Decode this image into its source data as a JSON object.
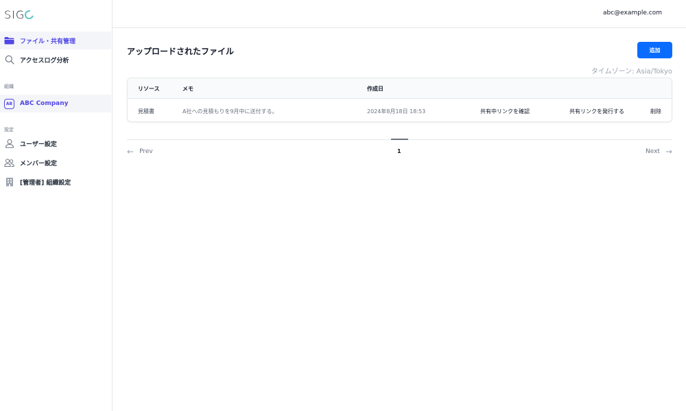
{
  "app": {
    "logo": "SIG"
  },
  "header": {
    "user_email": "abc@example.com"
  },
  "sidebar": {
    "items": [
      {
        "label": "ファイル・共有管理",
        "icon": "folder-icon",
        "active": true
      },
      {
        "label": "アクセスログ分析",
        "icon": "search-icon",
        "active": false
      }
    ],
    "org_section_label": "組織",
    "org": {
      "badge": "AB",
      "name": "ABC Company"
    },
    "settings_section_label": "設定",
    "settings_items": [
      {
        "label": "ユーザー設定",
        "icon": "user-icon"
      },
      {
        "label": "メンバー設定",
        "icon": "users-icon"
      },
      {
        "label": "[管理者] 組織設定",
        "icon": "building-icon"
      }
    ]
  },
  "main": {
    "title": "アップロードされたファイル",
    "add_button": "追加",
    "timezone": "タイムゾーン: Asia/Tokyo",
    "table": {
      "headers": [
        "リソース",
        "メモ",
        "作成日"
      ],
      "rows": [
        {
          "resource": "見積書",
          "memo": "A社への見積もりを9月中に送付する。",
          "created": "2024年8月18日 18:53",
          "action_view": "共有中リンクを確認",
          "action_issue": "共有リンクを発行する",
          "action_delete": "削除"
        }
      ]
    },
    "pagination": {
      "prev": "Prev",
      "page": "1",
      "next": "Next"
    }
  },
  "colors": {
    "accent": "#4f46e5",
    "primary_button": "#0a6cff",
    "logo_ring": "#5ec2c6"
  }
}
